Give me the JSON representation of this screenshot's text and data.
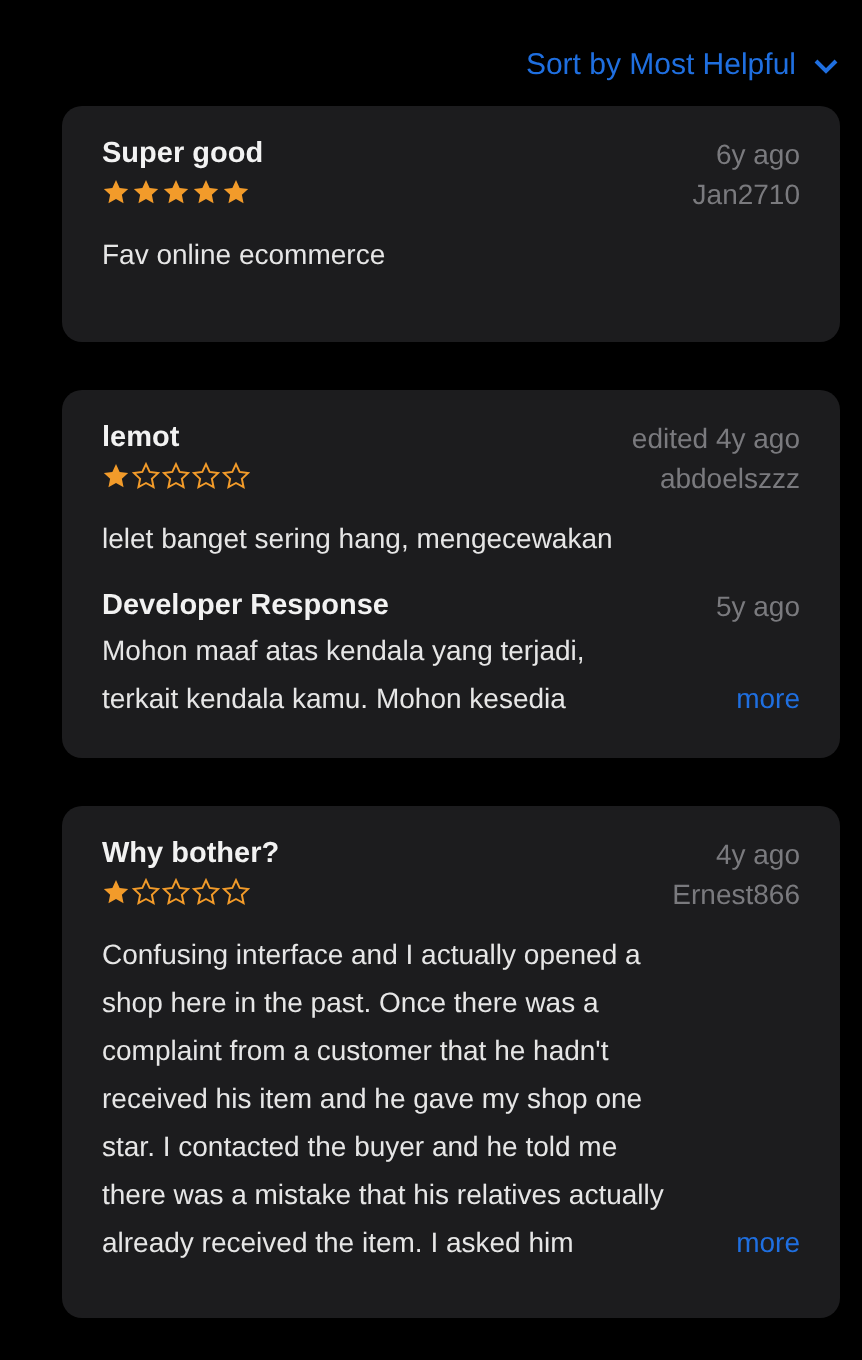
{
  "sort": {
    "label": "Sort by Most Helpful"
  },
  "reviews": [
    {
      "title": "Super good",
      "date": "6y ago",
      "author": "Jan2710",
      "stars": 5,
      "lines": [
        "Fav online ecommerce"
      ]
    },
    {
      "title": "lemot",
      "date": "edited 4y ago",
      "author": "abdoelszzz",
      "stars": 1,
      "lines": [
        "lelet banget sering hang, mengecewakan"
      ],
      "response": {
        "title": "Developer Response",
        "date": "5y ago",
        "lines": [
          "Mohon maaf atas kendala yang terjadi,",
          "terkait kendala kamu. Mohon kesedia"
        ],
        "more": "more"
      }
    },
    {
      "title": "Why bother?",
      "date": "4y ago",
      "author": "Ernest866",
      "stars": 1,
      "lines": [
        "Confusing interface and I actually opened a",
        "shop here in the past. Once there was a",
        "complaint from a customer that he hadn't",
        "received his item and he gave my shop one",
        "star. I contacted the buyer and he told me",
        "there was a mistake that his relatives actually",
        "already received the item. I asked him"
      ],
      "more": "more"
    }
  ]
}
